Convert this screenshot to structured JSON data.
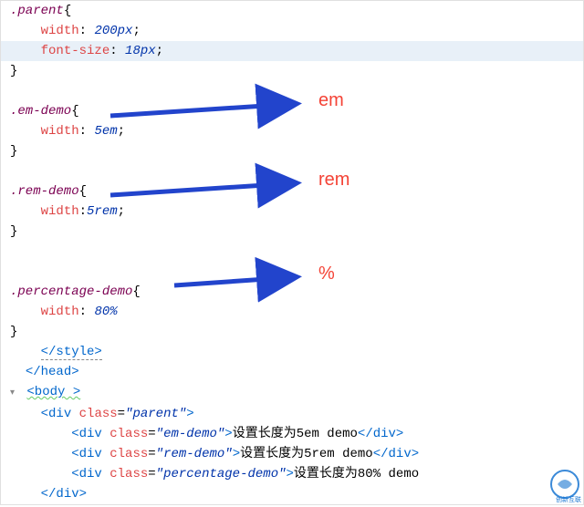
{
  "css": {
    "parent": {
      "selector": ".parent",
      "width_prop": "width",
      "width_val": "200px",
      "fs_prop": "font-size",
      "fs_val": "18px"
    },
    "em": {
      "selector": ".em-demo",
      "width_prop": "width",
      "width_val": "5em"
    },
    "rem": {
      "selector": ".rem-demo",
      "width_prop": "width",
      "width_val_raw": "5rem"
    },
    "pct": {
      "selector": ".percentage-demo",
      "width_prop": "width",
      "width_val": "80%"
    }
  },
  "labels": {
    "em": "em",
    "rem": "rem",
    "pct": "%"
  },
  "tags": {
    "style_close": "</style>",
    "head_close": "</head>",
    "body_open": "<body >",
    "div_open": "div",
    "div_close": "</div>",
    "class": "class"
  },
  "html": {
    "parent_class": "\"parent\"",
    "em_class": "\"em-demo\"",
    "em_text": "设置长度为5em demo",
    "rem_class": "\"rem-demo\"",
    "rem_text": "设置长度为5rem demo",
    "pct_class": "\"percentage-demo\"",
    "pct_text": "设置长度为80% demo"
  },
  "watermark": "创新互联"
}
